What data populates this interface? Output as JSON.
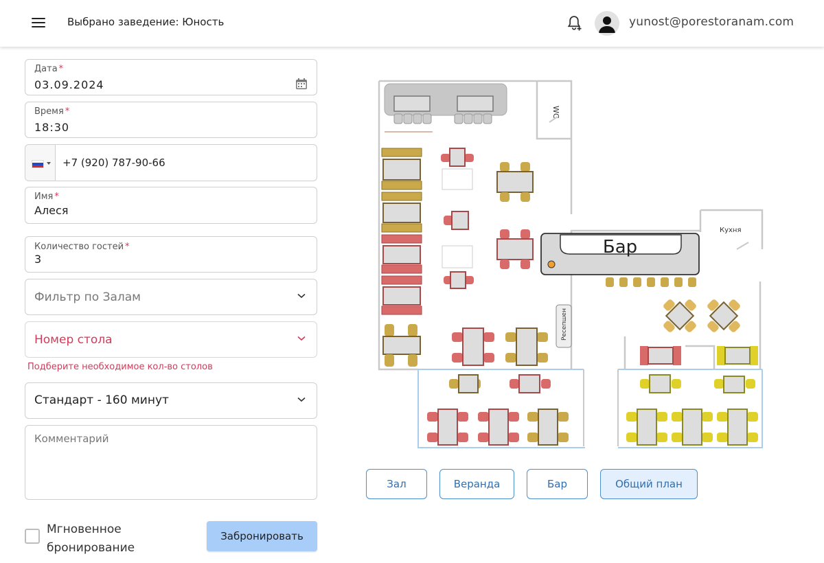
{
  "header": {
    "venue_title": "Выбрано заведение: Юность",
    "email": "yunost@porestoranam.com",
    "icons": [
      "menu-icon",
      "bell-plus-icon",
      "user-avatar-icon"
    ]
  },
  "form": {
    "date": {
      "label": "Дата",
      "required_mark": "*",
      "value": "03.09.2024"
    },
    "time": {
      "label": "Время",
      "required_mark": "*",
      "value": "18:30"
    },
    "phone": {
      "value": "+7 (920) 787-90-66",
      "country": "RU"
    },
    "name": {
      "label": "Имя",
      "required_mark": "*",
      "value": "Алеся"
    },
    "guests": {
      "label": "Количество гостей",
      "required_mark": "*",
      "value": "3"
    },
    "hall_filter": {
      "placeholder": "Фильтр по Залам"
    },
    "table_number": {
      "placeholder": "Номер стола",
      "error": "Подберите необходимое кол-во столов"
    },
    "duration": {
      "value": "Стандарт - 160 минут"
    },
    "comment": {
      "placeholder": "Комментарий"
    },
    "instant_booking": {
      "label": "Мгновенное бронирование",
      "checked": false
    },
    "submit_label": "Забронировать"
  },
  "plan": {
    "bar_label": "Бар",
    "kitchen_label": "Кухня",
    "wc_label": "WC",
    "reception_label": "Ресепшен"
  },
  "zones": [
    {
      "label": "Зал",
      "active": false
    },
    {
      "label": "Веранда",
      "active": false
    },
    {
      "label": "Бар",
      "active": false
    },
    {
      "label": "Общий план",
      "active": true
    }
  ],
  "colors": {
    "accent": "#4b8fcf",
    "primary_button": "#a8cdf9",
    "error": "#d33a5a",
    "table_olive": "#b89a2e",
    "table_red": "#d96a6a",
    "table_yellow": "#e0d02a"
  }
}
